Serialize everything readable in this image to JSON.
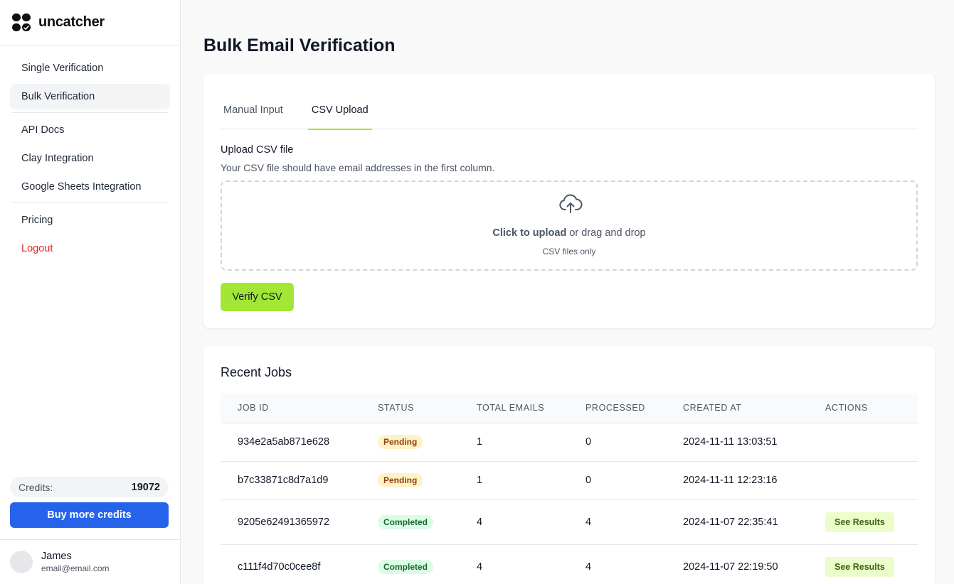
{
  "brand": {
    "name": "uncatcher"
  },
  "sidebar": {
    "items": [
      {
        "label": "Single Verification"
      },
      {
        "label": "Bulk Verification"
      },
      {
        "label": "API Docs"
      },
      {
        "label": "Clay Integration"
      },
      {
        "label": "Google Sheets Integration"
      },
      {
        "label": "Pricing"
      },
      {
        "label": "Logout"
      }
    ],
    "credits_label": "Credits:",
    "credits_value": "19072",
    "buy_button": "Buy more credits",
    "user": {
      "name": "James",
      "email": "email@email.com"
    }
  },
  "page": {
    "title": "Bulk Email Verification"
  },
  "upload": {
    "tabs": [
      {
        "label": "Manual Input"
      },
      {
        "label": "CSV Upload"
      }
    ],
    "active_tab": "CSV Upload",
    "label": "Upload CSV file",
    "hint": "Your CSV file should have email addresses in the first column.",
    "dropzone_action": "Click to upload",
    "dropzone_rest": "or drag and drop",
    "dropzone_sub": "CSV files only",
    "verify_button": "Verify CSV"
  },
  "jobs": {
    "title": "Recent Jobs",
    "columns": [
      "JOB ID",
      "STATUS",
      "TOTAL EMAILS",
      "PROCESSED",
      "CREATED AT",
      "ACTIONS"
    ],
    "rows": [
      {
        "id": "934e2a5ab871e628",
        "status": "Pending",
        "total": "1",
        "processed": "0",
        "created": "2024-11-11 13:03:51",
        "action": ""
      },
      {
        "id": "b7c33871c8d7a1d9",
        "status": "Pending",
        "total": "1",
        "processed": "0",
        "created": "2024-11-11 12:23:16",
        "action": ""
      },
      {
        "id": "9205e62491365972",
        "status": "Completed",
        "total": "4",
        "processed": "4",
        "created": "2024-11-07 22:35:41",
        "action": "See Results"
      },
      {
        "id": "c111f4d70c0cee8f",
        "status": "Completed",
        "total": "4",
        "processed": "4",
        "created": "2024-11-07 22:19:50",
        "action": "See Results"
      }
    ]
  },
  "colors": {
    "accent": "#a3e635",
    "primary": "#2563eb",
    "logout": "#dc2626"
  }
}
